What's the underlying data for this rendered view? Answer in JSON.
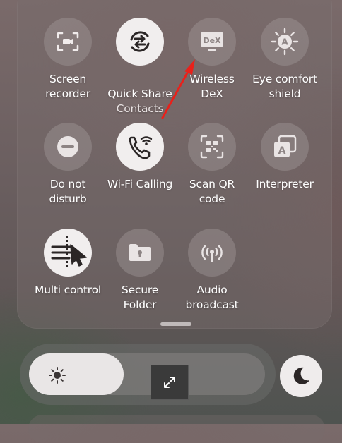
{
  "tiles": {
    "screen_recorder": {
      "label": "Screen\nrecorder",
      "icon": "screen-recorder-icon",
      "active": false
    },
    "quick_share": {
      "label": "Quick Share",
      "sub": "Contacts",
      "icon": "quick-share-icon",
      "active": true
    },
    "wireless_dex": {
      "label": "Wireless\nDeX",
      "icon": "dex-icon",
      "icon_text": "DeX",
      "active": false
    },
    "eye_comfort": {
      "label": "Eye comfort\nshield",
      "icon": "eye-comfort-icon",
      "icon_text": "A",
      "active": false
    },
    "do_not_disturb": {
      "label": "Do not\ndisturb",
      "icon": "minus-circle-icon",
      "active": false
    },
    "wifi_calling": {
      "label": "Wi-Fi Calling",
      "icon": "wifi-calling-icon",
      "active": true
    },
    "scan_qr": {
      "label": "Scan QR\ncode",
      "icon": "qr-scan-icon",
      "active": false
    },
    "interpreter": {
      "label": "Interpreter",
      "icon": "interpreter-icon",
      "icon_text": "A",
      "active": false
    },
    "multi_control": {
      "label": "Multi control",
      "icon": "multi-control-icon",
      "active": true
    },
    "secure_folder": {
      "label": "Secure\nFolder",
      "icon": "secure-folder-icon",
      "active": false
    },
    "audio_broadcast": {
      "label": "Audio\nbroadcast",
      "icon": "audio-broadcast-icon",
      "active": false
    }
  },
  "brightness": {
    "level": 0.4,
    "icon": "sun-icon"
  },
  "controls": {
    "expand_icon": "expand-icon",
    "dark_mode_icon": "moon-icon"
  },
  "annotation": {
    "type": "red-arrow",
    "target": "wireless_dex",
    "color": "#e8211b"
  },
  "colors": {
    "tile_active": "#f1eeee",
    "tile_inactive": "rgba(160,150,150,0.45)",
    "label": "#ffffff"
  }
}
